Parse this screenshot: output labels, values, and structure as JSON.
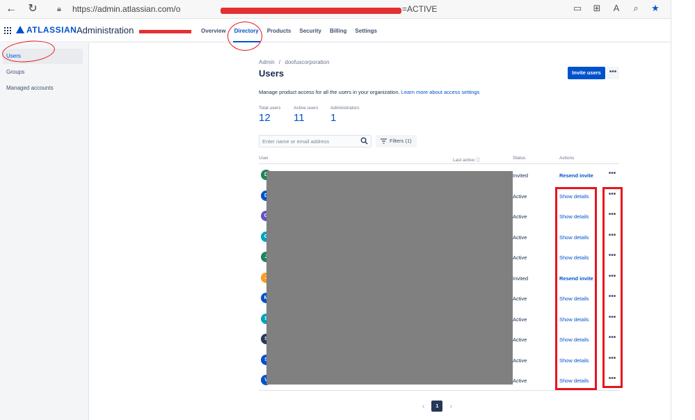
{
  "browser": {
    "url_prefix": "https://admin.atlassian.com/o",
    "url_suffix": "=ACTIVE",
    "icons": [
      "back-icon",
      "refresh-icon",
      "lock-icon",
      "app-available-icon",
      "extensions-icon",
      "read-aloud-icon",
      "zoom-icon",
      "favorite-star-icon"
    ]
  },
  "header": {
    "logo": "ATLASSIAN",
    "app_name": "Administration",
    "tabs": [
      "Overview",
      "Directory",
      "Products",
      "Security",
      "Billing",
      "Settings"
    ],
    "active_tab": "Directory"
  },
  "sidebar": {
    "items": [
      {
        "label": "Users",
        "active": true
      },
      {
        "label": "Groups",
        "active": false
      },
      {
        "label": "Managed accounts",
        "active": false
      }
    ]
  },
  "main": {
    "breadcrumb_root": "Admin",
    "breadcrumb_sep": "/",
    "breadcrumb_org": "doofuscorporation",
    "title": "Users",
    "invite_button": "Invite users",
    "more_label": "•••",
    "description": "Manage product access for all the users in your organization.",
    "learn_more": "Learn more about access settings",
    "stats": [
      {
        "label": "Total users",
        "value": "12"
      },
      {
        "label": "Active users",
        "value": "11"
      },
      {
        "label": "Administrators",
        "value": "1"
      }
    ],
    "search_placeholder": "Enter name or email address",
    "filters_label": "Filters (1)",
    "columns": {
      "user": "User",
      "last_active": "Last active ⓘ",
      "status": "Status",
      "actions": "Actions"
    },
    "rows": [
      {
        "initial": "D",
        "color": "#1f845a",
        "status": "Invited",
        "action": "Resend invite",
        "bold": true
      },
      {
        "initial": "D",
        "color": "#0052cc",
        "status": "Active",
        "action": "Show details",
        "bold": false
      },
      {
        "initial": "G",
        "color": "#6554c0",
        "status": "Active",
        "action": "Show details",
        "bold": false
      },
      {
        "initial": "G",
        "color": "#00a3bf",
        "status": "Active",
        "action": "Show details",
        "bold": false
      },
      {
        "initial": "J",
        "color": "#1f845a",
        "status": "Active",
        "action": "Show details",
        "bold": false
      },
      {
        "initial": "J",
        "color": "#ff991f",
        "status": "Invited",
        "action": "Resend invite",
        "bold": true
      },
      {
        "initial": "M",
        "color": "#0052cc",
        "status": "Active",
        "action": "Show details",
        "bold": false
      },
      {
        "initial": "S",
        "color": "#00a3bf",
        "status": "Active",
        "action": "Show details",
        "bold": false
      },
      {
        "initial": "S",
        "color": "#253858",
        "status": "Active",
        "action": "Show details",
        "bold": false
      },
      {
        "initial": "S",
        "color": "#0052cc",
        "status": "Active",
        "action": "Show details",
        "bold": false
      },
      {
        "initial": "V",
        "color": "#0052cc",
        "status": "Active",
        "action": "Show details",
        "bold": false
      }
    ],
    "pagination": {
      "prev": "‹",
      "current": "1",
      "next": "›"
    }
  }
}
